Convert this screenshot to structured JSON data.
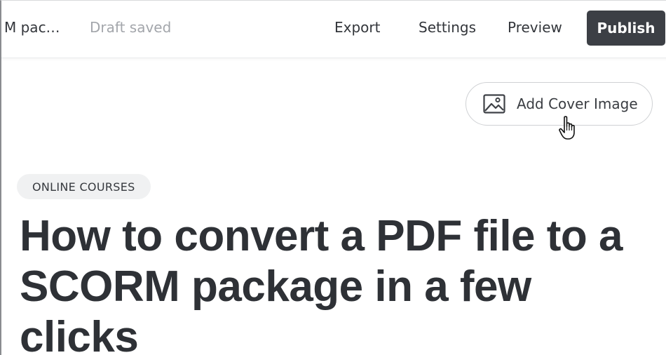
{
  "toolbar": {
    "doc_title": "M pac…",
    "draft_status": "Draft saved",
    "export_label": "Export",
    "settings_label": "Settings",
    "preview_label": "Preview",
    "publish_label": "Publish"
  },
  "cover": {
    "button_label": "Add Cover Image",
    "icon": "image-icon"
  },
  "article": {
    "category": "ONLINE COURSES",
    "headline": "How to convert a PDF file to a SCORM package in a few clicks"
  },
  "colors": {
    "publish_bg": "#3c3f45",
    "muted_text": "#a3a6ab",
    "body_text": "#2e3136",
    "chip_bg": "#f0f1f2"
  }
}
